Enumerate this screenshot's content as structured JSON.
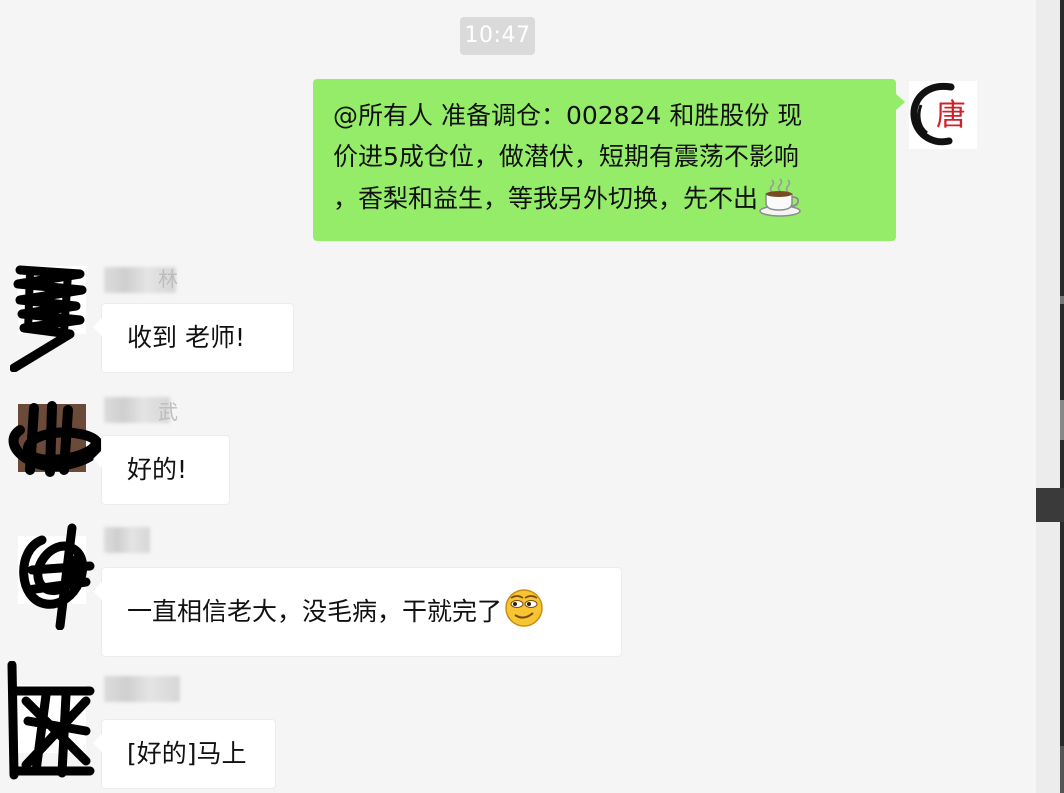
{
  "timestamp": "10:47",
  "outgoing": {
    "lines": [
      "@所有人  准备调仓：002824  和胜股份  现",
      "价进5成仓位，做潜伏，短期有震荡不影响",
      "，香梨和益生，等我另外切换，先不出"
    ],
    "trailing_icon": "coffee-cup-icon",
    "avatar_glyph": "唐"
  },
  "incoming": [
    {
      "name_fragment": "林",
      "text": "收到 老师!"
    },
    {
      "name_fragment": "武",
      "text": "好的!"
    },
    {
      "name_fragment": "",
      "text": "一直相信老大，没毛病，干就完了",
      "trailing_icon": "smirk-face-icon"
    },
    {
      "name_fragment": "",
      "text": "[好的]马上"
    }
  ],
  "colors": {
    "background": "#f5f5f5",
    "outgoing_bubble": "#95ec69",
    "incoming_bubble": "#ffffff",
    "time_chip": "#dadada"
  }
}
